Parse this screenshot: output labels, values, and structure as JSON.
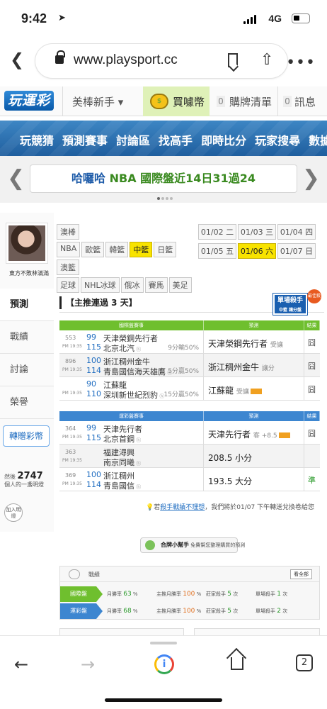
{
  "status": {
    "time": "9:42",
    "network": "4G"
  },
  "browser": {
    "url": "www.playsport.cc",
    "tab_count": "2"
  },
  "header": {
    "logo": "玩運彩",
    "rookie": "美棒新手",
    "rookie_caret": "▾",
    "buy_coin": "買噱幣",
    "cart_count": "0",
    "cart": "購牌清單",
    "msg_count": "0",
    "msg": "訊息"
  },
  "nav": {
    "items": [
      "玩競猜",
      "預測賽事",
      "討論區",
      "找高手",
      "即時比分",
      "玩家搜尋",
      "數據"
    ]
  },
  "promo": {
    "prefix": "哈囉哈",
    "text": "NBA 國際盤近14日31過24"
  },
  "sidebar": {
    "username": "東方不敗林滿滿",
    "menu": [
      {
        "label": "預測",
        "active": true
      },
      {
        "label": "戰績"
      },
      {
        "label": "討論"
      },
      {
        "label": "榮譽"
      }
    ],
    "gift": "轉贈彩幣",
    "count_prefix": "然後",
    "count": "2747",
    "count_suffix": "個人的一盞明燈",
    "follow": "加入明燈"
  },
  "main": {
    "tags_row1": [
      "澳棒"
    ],
    "tags_row2": [
      "NBA",
      "歐籃",
      "韓籃",
      "中籃",
      "日籃"
    ],
    "tags_row3": [
      "澳籃"
    ],
    "tags_row4": [
      "足球",
      "NHL冰球",
      "俄冰",
      "賽馬",
      "美足"
    ],
    "highlight_tag": "中籃",
    "days": [
      [
        "01/02 二",
        "01/03 三",
        "01/04 四"
      ],
      [
        "01/05 五",
        "01/06 六",
        "01/07 日"
      ]
    ],
    "active_day": "01/06 六",
    "streak": "【主推連過 3 天】",
    "killer_badge": "單場殺手",
    "killer_sub": "中籃 讓分盤",
    "killer_award": "最佳殺手",
    "intl": {
      "header": [
        "國際盤賽事",
        "預測",
        "結果"
      ],
      "color": "#6fbf2e",
      "rows": [
        {
          "no": "553",
          "time": "PM 19:35",
          "s1": "99",
          "s2": "115",
          "t1": "天津榮鋼先行者",
          "t2": "北京北汽",
          "note": "9分輸50%",
          "pick": "天津榮鋼先行者",
          "pick_note": "受讓",
          "flag": false,
          "result": "囧",
          "win": false
        },
        {
          "no": "896",
          "time": "PM 19:35",
          "s1": "100",
          "s2": "114",
          "t1": "浙江稠州金牛",
          "t2": "青島國信海天雄鷹",
          "note": "5分贏50%",
          "pick": "浙江稠州金牛",
          "pick_note": "讓分",
          "flag": false,
          "result": "囧",
          "win": false
        },
        {
          "no": "",
          "time": "PM 19:35",
          "s1": "90",
          "s2": "110",
          "t1": "江蘇龍",
          "t2": "深圳新世紀烈豹",
          "note": "15分贏50%",
          "pick": "江蘇龍",
          "pick_note": "受讓",
          "flag": true,
          "result": "囧",
          "win": false
        }
      ]
    },
    "local": {
      "header": [
        "運彩盤賽事",
        "預測",
        "結果"
      ],
      "color": "#3d86d0",
      "rows": [
        {
          "no": "364",
          "time": "PM 19:35",
          "s1": "99",
          "s2": "115",
          "t1": "天津先行者",
          "t2": "北京首鋼",
          "note": "",
          "pick": "天津先行者",
          "pick_note": "客 +8.5",
          "flag": true,
          "result": "囧",
          "win": false
        },
        {
          "no": "363",
          "time": "PM 19:35",
          "s1": "",
          "s2": "",
          "t1": "福建潯興",
          "t2": "南京同曦",
          "note": "",
          "pick": "208.5 小分",
          "pick_note": "",
          "flag": false,
          "result": "",
          "win": false
        },
        {
          "no": "369",
          "time": "PM 19:35",
          "s1": "100",
          "s2": "114",
          "t1": "浙江稠州",
          "t2": "青島國信",
          "note": "",
          "pick": "193.5 大分",
          "pick_note": "",
          "flag": false,
          "result": "準",
          "win": true
        }
      ]
    },
    "note_prefix": "若",
    "note_link": "殺手戰績不理想",
    "note_suffix": "，我們將於01/07 下午轉送兌換卷給您",
    "helper_title": "合牌小幫手",
    "helper_sub": "免費幫您整理購買的預測",
    "stats": {
      "title": "戰績",
      "see_all": "看全部",
      "rows": [
        {
          "label": "國際盤",
          "color": "#6fbf2e",
          "v1": "月勝率 63 %",
          "v2": "主推月勝率 100 %",
          "v3": "莊家殺手 5 次",
          "v4": "單場殺手 1 次"
        },
        {
          "label": "運彩盤",
          "color": "#3d86d0",
          "v1": "月勝率 68 %",
          "v2": "主推月勝率 100 %",
          "v3": "莊家殺手 5 次",
          "v4": "單場殺手 2 次"
        }
      ]
    }
  }
}
